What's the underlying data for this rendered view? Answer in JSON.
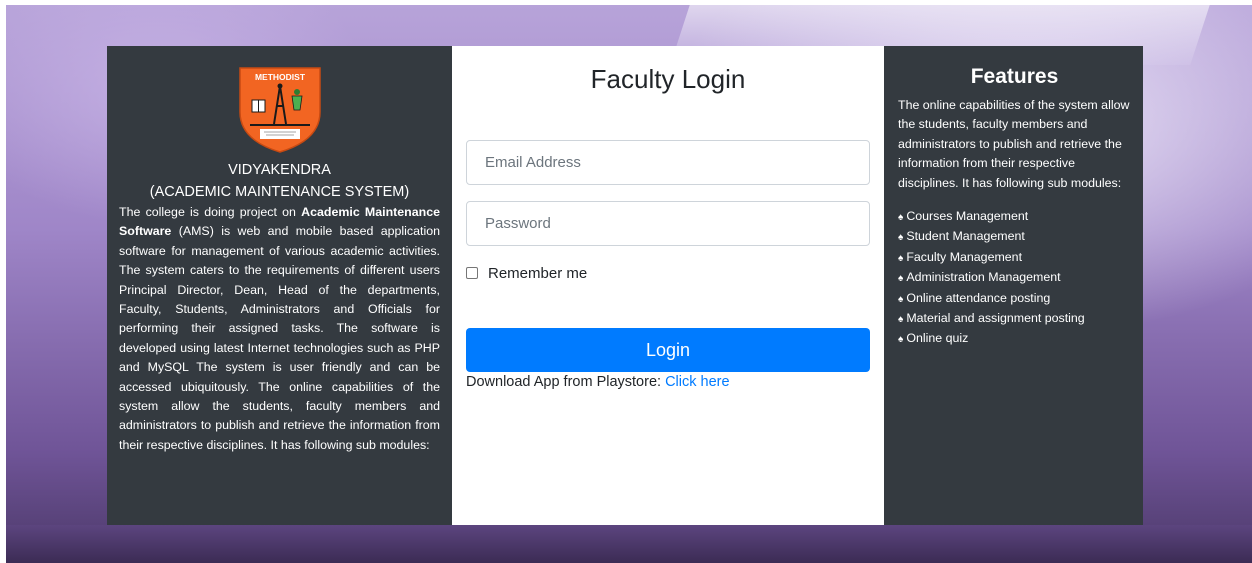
{
  "left": {
    "logo_text": "METHODIST",
    "org_name": "VIDYAKENDRA",
    "org_subtitle": "(ACADEMIC MAINTENANCE SYSTEM)",
    "about_prefix": "The college is doing project on ",
    "about_bold": "Academic Maintenance Software",
    "about_rest": " (AMS) is web and mobile based application software for management of various academic activities. The system caters to the requirements of different users Principal Director, Dean, Head of the departments, Faculty, Students, Administrators and Officials for performing their assigned tasks. The software is developed using latest Internet technologies such as PHP and MySQL The system is user friendly and can be accessed ubiquitously. The online capabilities of the system allow the students, faculty members and administrators to publish and retrieve the information from their respective disciplines. It has following sub modules:"
  },
  "login": {
    "title": "Faculty Login",
    "email_placeholder": "Email Address",
    "password_placeholder": "Password",
    "remember_label": "Remember me",
    "button_label": "Login",
    "download_text": "Download App from Playstore: ",
    "download_link": "Click here"
  },
  "features": {
    "title": "Features",
    "description": "The online capabilities of the system allow the students, faculty members and administrators to publish and retrieve the information from their respective disciplines. It has following sub modules:",
    "bullet_icon": "spade-icon",
    "items": [
      "Courses Management",
      "Student Management",
      "Faculty Management",
      "Administration Management",
      "Online attendance posting",
      "Material and assignment posting",
      "Online quiz"
    ]
  },
  "colors": {
    "panel_dark": "#343a40",
    "accent_blue": "#007bff",
    "logo_orange": "#f26522"
  }
}
